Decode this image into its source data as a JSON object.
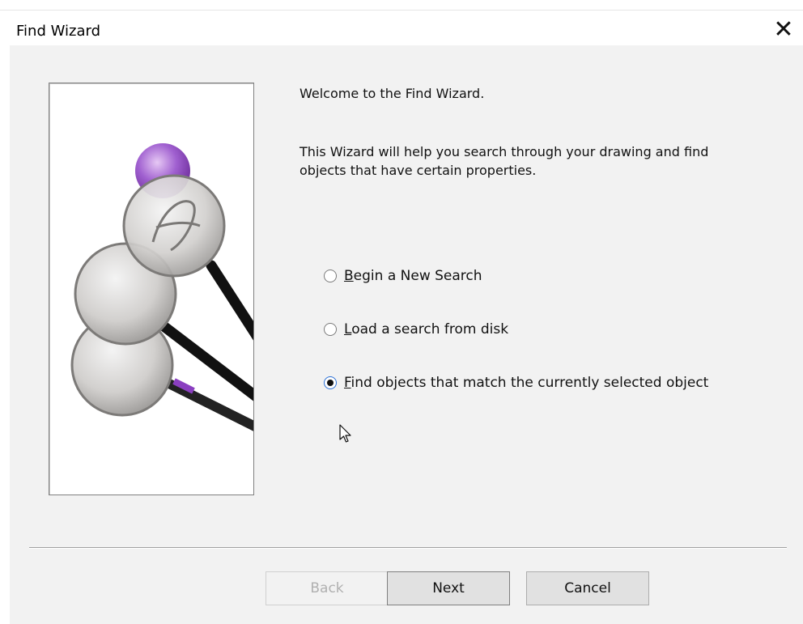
{
  "window": {
    "title": "Find Wizard",
    "close_symbol": "✕"
  },
  "content": {
    "welcome": "Welcome to the Find Wizard.",
    "description": "This Wizard will help you search through your drawing and find objects that have certain properties."
  },
  "options": [
    {
      "accel": "B",
      "rest": "egin a New Search",
      "checked": false
    },
    {
      "accel": "L",
      "rest": "oad a search from disk",
      "checked": false
    },
    {
      "accel": "F",
      "rest": "ind objects that match the currently selected object",
      "checked": true
    }
  ],
  "buttons": {
    "back": "Back",
    "next": "Next",
    "cancel": "Cancel"
  },
  "illustration": {
    "icon": "magnifying-glasses-icon",
    "accent_color": "#8a3fc0"
  }
}
